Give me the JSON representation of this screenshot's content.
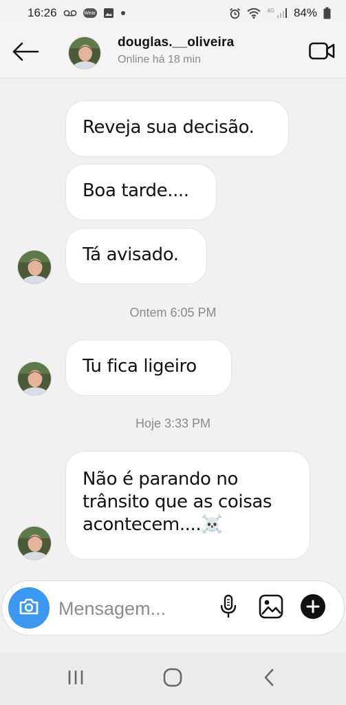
{
  "status_bar": {
    "time": "16:26",
    "battery": "84%",
    "network": "4G",
    "icons": [
      "voicemail-icon",
      "wear-icon",
      "image-icon",
      "dot-icon",
      "alarm-icon",
      "wifi-icon",
      "signal-icon",
      "battery-icon"
    ],
    "wear_label": "Wear"
  },
  "header": {
    "username": "douglas.__oliveira",
    "status": "Online há 18 min",
    "icons": [
      "back-arrow-icon",
      "video-camera-icon"
    ]
  },
  "chat": {
    "messages": [
      {
        "text": "Reveja sua decisão."
      },
      {
        "text": "Boa tarde...."
      },
      {
        "text": "Tá avisado."
      },
      {
        "text": "Tu fica ligeiro"
      },
      {
        "line1": "Não é parando no",
        "line2": "trânsito que as coisas",
        "line3": "acontecem....☠️"
      }
    ],
    "timestamps": [
      "Ontem 6:05 PM",
      "Hoje 3:33 PM"
    ]
  },
  "composer": {
    "placeholder": "Mensagem...",
    "icons": [
      "camera-icon",
      "microphone-icon",
      "gallery-icon",
      "plus-icon"
    ]
  },
  "nav": {
    "icons": [
      "recent-apps-icon",
      "home-icon",
      "back-icon"
    ]
  },
  "colors": {
    "accent": "#3b97f0",
    "background": "#f1f1f1",
    "bubble": "#ffffff",
    "muted_text": "#8a8a8a"
  }
}
